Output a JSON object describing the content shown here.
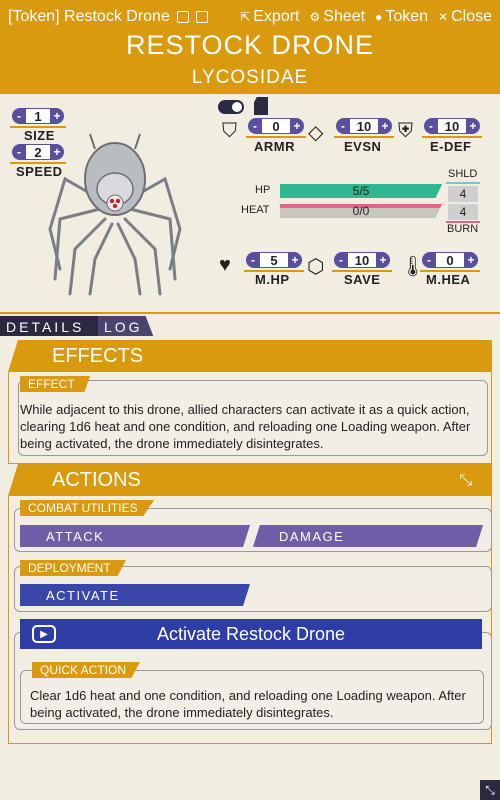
{
  "window": {
    "title": "[Token] Restock Drone",
    "actions": [
      {
        "label": "Export",
        "icon": "export-icon"
      },
      {
        "label": "Sheet",
        "icon": "gear-icon"
      },
      {
        "label": "Token",
        "icon": "user-icon"
      },
      {
        "label": "Close",
        "icon": "close-icon"
      }
    ]
  },
  "header": {
    "name": "RESTOCK DRONE",
    "class": "LYCOSIDAE"
  },
  "stats": {
    "size": {
      "label": "SIZE",
      "value": "1"
    },
    "speed": {
      "label": "SPEED",
      "value": "2"
    },
    "armor": {
      "label": "ARMR",
      "value": "0"
    },
    "evasion": {
      "label": "EVSN",
      "value": "10"
    },
    "edef": {
      "label": "E-DEF",
      "value": "10"
    },
    "hp": {
      "label": "HP",
      "value": "5/5",
      "fraction": 1.0
    },
    "heat": {
      "label": "HEAT",
      "value": "0/0",
      "fraction": 0.0
    },
    "shield": {
      "label": "SHLD",
      "value": "4"
    },
    "burn": {
      "label": "BURN",
      "value": "4"
    },
    "max_hp": {
      "label": "M.HP",
      "value": "5"
    },
    "save": {
      "label": "SAVE",
      "value": "10"
    },
    "max_heat": {
      "label": "M.HEA",
      "value": "0"
    }
  },
  "tabs": {
    "details": "DETAILS",
    "log": "LOG"
  },
  "effects": {
    "title": "EFFECTS",
    "sub": "EFFECT",
    "text": "While adjacent to this drone, allied characters can activate it as a quick action, clearing 1d6 heat and one condition, and reloading one Loading weapon. After being activated, the drone immediately disintegrates."
  },
  "actions": {
    "title": "ACTIONS",
    "combat_label": "COMBAT UTILITIES",
    "attack": "ATTACK",
    "damage": "DAMAGE",
    "deploy_label": "DEPLOYMENT",
    "activate": "ACTIVATE",
    "action_title": "Activate Restock Drone",
    "quick_label": "QUICK ACTION",
    "quick_text": "Clear 1d6 heat and one condition, and reloading one Loading weapon. After being activated, the drone immediately disintegrates."
  },
  "colors": {
    "accent": "#d99a0f",
    "purple": "#6e5ea8",
    "blue": "#2e3da6",
    "dark": "#2b2842"
  }
}
